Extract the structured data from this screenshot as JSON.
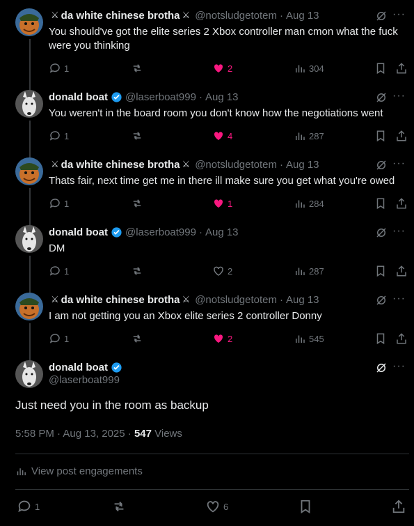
{
  "posts": [
    {
      "name": "da white chinese brotha",
      "handle": "@notsludgetotem",
      "date": "Aug 13",
      "text": "You should've got the elite series 2  Xbox controller man cmon what the fuck were you thinking",
      "replies": "1",
      "likes": "2",
      "views": "304",
      "liked": true
    },
    {
      "name": "donald boat",
      "handle": "@laserboat999",
      "date": "Aug 13",
      "text": "You weren't in the board room you don't know how the negotiations went",
      "replies": "1",
      "likes": "4",
      "views": "287",
      "liked": true
    },
    {
      "name": "da white chinese brotha",
      "handle": "@notsludgetotem",
      "date": "Aug 13",
      "text": "Thats fair, next time get me in there ill make sure you get what you're owed",
      "replies": "1",
      "likes": "1",
      "views": "284",
      "liked": true
    },
    {
      "name": "donald boat",
      "handle": "@laserboat999",
      "date": "Aug 13",
      "text": "DM",
      "replies": "1",
      "likes": "2",
      "views": "287",
      "liked": false
    },
    {
      "name": "da white chinese brotha",
      "handle": "@notsludgetotem",
      "date": "Aug 13",
      "text": "I am not getting you an Xbox elite series 2 controller Donny",
      "replies": "1",
      "likes": "2",
      "views": "545",
      "liked": true
    }
  ],
  "main_post": {
    "name": "donald boat",
    "handle": "@laserboat999",
    "text": "Just need you in the room as backup",
    "time": "5:58 PM · Aug 13, 2025 · ",
    "views_count": "547",
    "views_label": " Views",
    "engagements_label": "View post engagements",
    "replies": "1",
    "likes": "6"
  },
  "separator": "·",
  "more_label": "···",
  "colors": {
    "background": "#000000",
    "text": "#e7e9ea",
    "muted": "#71767b",
    "like": "#f91880",
    "verified": "#1d9bf0",
    "divider": "#2f3336"
  },
  "icons": {
    "reply": "reply-icon",
    "repost": "repost-icon",
    "like": "heart-icon",
    "views": "views-icon",
    "bookmark": "bookmark-icon",
    "share": "share-icon",
    "grok": "grok-icon",
    "more": "more-icon",
    "verified": "verified-badge-icon",
    "swords": "crossed-swords-icon"
  }
}
